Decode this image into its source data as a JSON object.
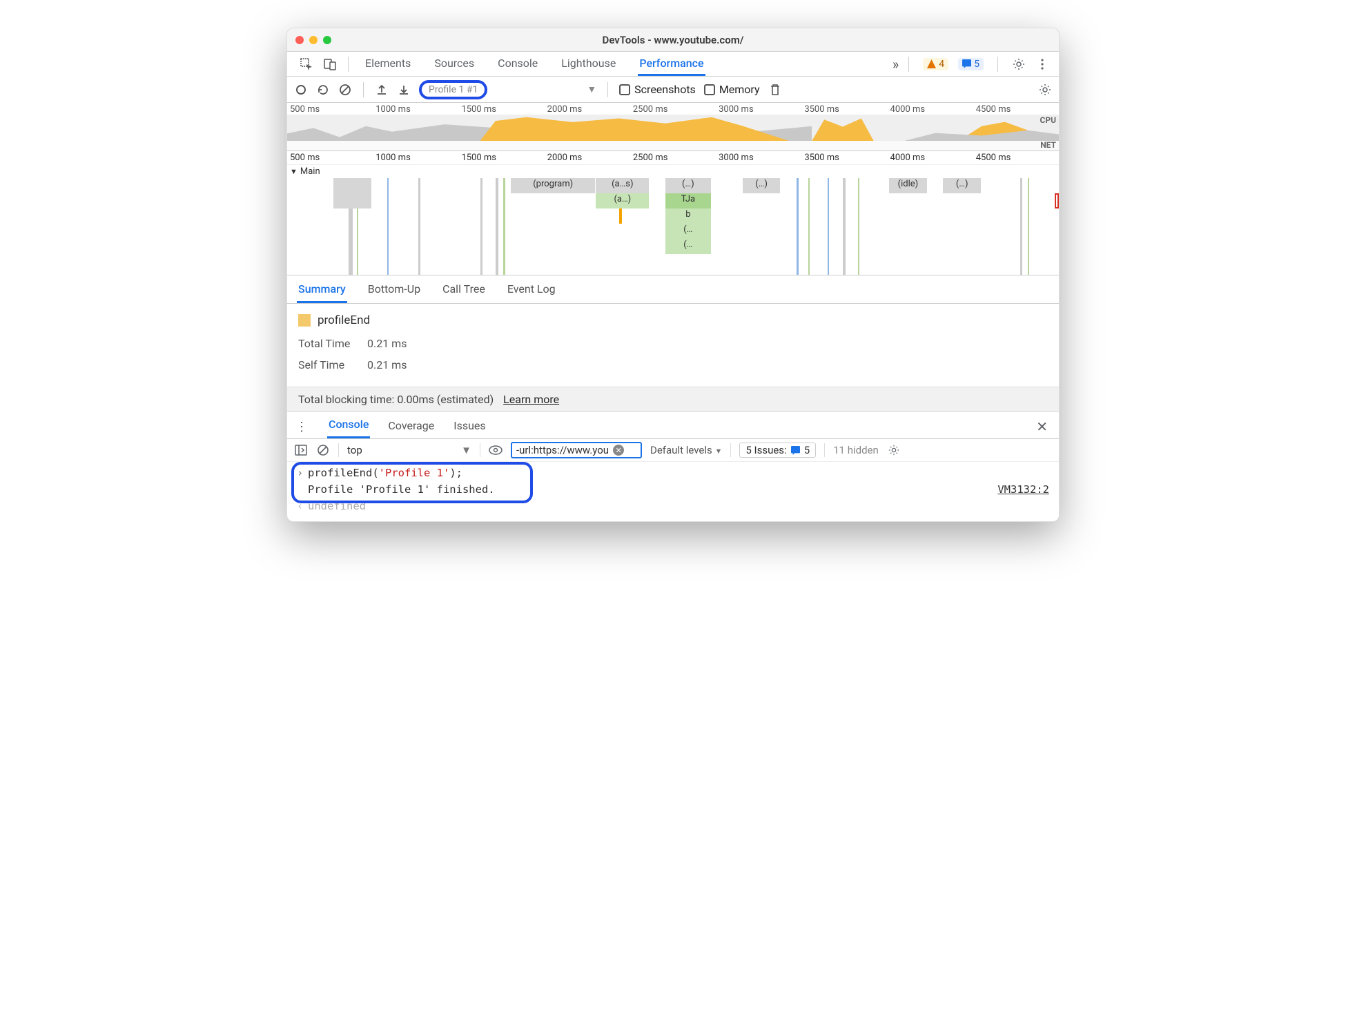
{
  "window": {
    "title": "DevTools - www.youtube.com/"
  },
  "mainTabs": {
    "items": [
      "Elements",
      "Sources",
      "Console",
      "Lighthouse",
      "Performance"
    ],
    "active": "Performance",
    "overflow": "»"
  },
  "status": {
    "warnings": "4",
    "messages": "5"
  },
  "perfToolbar": {
    "profileLabel": "Profile 1 #1",
    "screenshots": "Screenshots",
    "memory": "Memory"
  },
  "timeline": {
    "ticks": [
      "500 ms",
      "1000 ms",
      "1500 ms",
      "2000 ms",
      "2500 ms",
      "3000 ms",
      "3500 ms",
      "4000 ms",
      "4500 ms"
    ],
    "cpuLabel": "CPU",
    "netLabel": "NET"
  },
  "flame": {
    "mainLabel": "Main",
    "cells": {
      "program": "(program)",
      "a_s": "(a…s)",
      "a": "(a…)",
      "ellipsis": "(…)",
      "tja": "TJa",
      "b": "b",
      "e2": "(…",
      "e3": "(…",
      "idle": "(idle)",
      "e4": "(…)"
    }
  },
  "detailTabs": [
    "Summary",
    "Bottom-Up",
    "Call Tree",
    "Event Log"
  ],
  "summary": {
    "eventName": "profileEnd",
    "totalTimeLabel": "Total Time",
    "totalTimeValue": "0.21 ms",
    "selfTimeLabel": "Self Time",
    "selfTimeValue": "0.21 ms"
  },
  "blocking": {
    "text": "Total blocking time: 0.00ms (estimated)",
    "learnMore": "Learn more"
  },
  "drawerTabs": [
    "Console",
    "Coverage",
    "Issues"
  ],
  "consoleToolbar": {
    "context": "top",
    "filter": "-url:https://www.you",
    "levels": "Default levels",
    "issuesLabel": "5 Issues:",
    "issuesCount": "5",
    "hidden": "11 hidden"
  },
  "consoleLines": {
    "cmd_prefix": "profileEnd(",
    "cmd_str": "'Profile 1'",
    "cmd_suffix": ");",
    "output": "Profile 'Profile 1' finished.",
    "source": "VM3132:2",
    "undef": "undefined"
  }
}
